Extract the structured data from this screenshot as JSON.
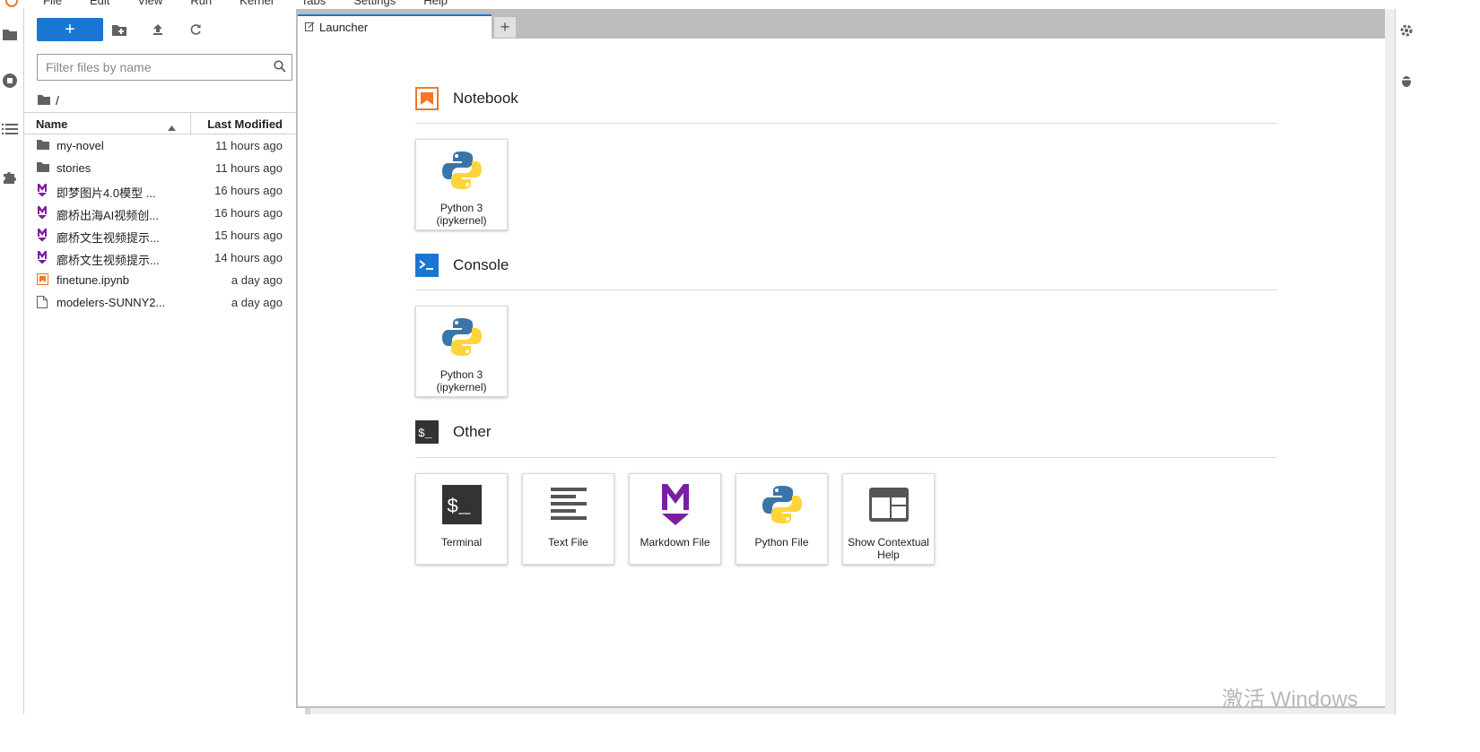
{
  "menubar": {
    "items": [
      "File",
      "Edit",
      "View",
      "Run",
      "Kernel",
      "Tabs",
      "Settings",
      "Help"
    ]
  },
  "activity_bar": {
    "icons": [
      "folder-icon",
      "running-icon",
      "toc-icon",
      "extension-icon"
    ]
  },
  "file_browser": {
    "new_button_label": "+",
    "search_placeholder": "Filter files by name",
    "breadcrumb_path": "/",
    "columns": {
      "name": "Name",
      "modified": "Last Modified"
    },
    "files": [
      {
        "name": "my-novel",
        "modified": "11 hours ago",
        "type": "folder"
      },
      {
        "name": "stories",
        "modified": "11 hours ago",
        "type": "folder"
      },
      {
        "name": "即梦图片4.0模型 ...",
        "modified": "16 hours ago",
        "type": "markdown"
      },
      {
        "name": "廊桥出海AI视频创...",
        "modified": "16 hours ago",
        "type": "markdown"
      },
      {
        "name": "廊桥文生视频提示...",
        "modified": "15 hours ago",
        "type": "markdown"
      },
      {
        "name": "廊桥文生视频提示...",
        "modified": "14 hours ago",
        "type": "markdown"
      },
      {
        "name": "finetune.ipynb",
        "modified": "a day ago",
        "type": "notebook"
      },
      {
        "name": "modelers-SUNNY2...",
        "modified": "a day ago",
        "type": "file"
      }
    ]
  },
  "tabs": {
    "active_label": "Launcher",
    "add_label": "+"
  },
  "launcher": {
    "sections": [
      {
        "title": "Notebook",
        "cards": [
          {
            "label": "Python 3 (ipykernel)",
            "icon": "python-icon"
          }
        ]
      },
      {
        "title": "Console",
        "cards": [
          {
            "label": "Python 3 (ipykernel)",
            "icon": "python-icon"
          }
        ]
      },
      {
        "title": "Other",
        "cards": [
          {
            "label": "Terminal",
            "icon": "terminal-icon"
          },
          {
            "label": "Text File",
            "icon": "text-file-icon"
          },
          {
            "label": "Markdown File",
            "icon": "markdown-icon"
          },
          {
            "label": "Python File",
            "icon": "python-icon"
          },
          {
            "label": "Show Contextual Help",
            "icon": "contextual-help-icon"
          }
        ]
      }
    ]
  },
  "watermark": "激活 Windows",
  "colors": {
    "accent": "#1976d2",
    "notebook_orange": "#f37726",
    "markdown_purple": "#7b1fa2",
    "python_blue": "#3a75a8",
    "python_yellow": "#ffd43b"
  }
}
